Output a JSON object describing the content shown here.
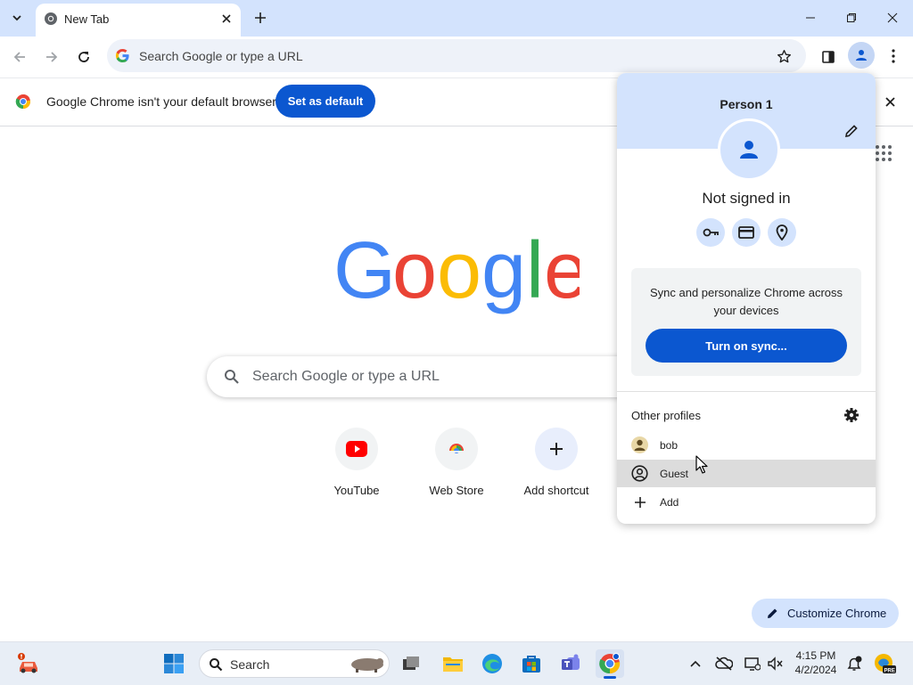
{
  "tab": {
    "title": "New Tab"
  },
  "omnibox": {
    "placeholder": "Search Google or type a URL"
  },
  "infobar": {
    "message": "Google Chrome isn't your default browser",
    "set_default_label": "Set as default"
  },
  "ntp": {
    "search_placeholder": "Search Google or type a URL",
    "shortcuts": [
      {
        "label": "YouTube",
        "icon": "youtube-icon"
      },
      {
        "label": "Web Store",
        "icon": "web-store-icon"
      },
      {
        "label": "Add shortcut",
        "icon": "plus-icon"
      }
    ],
    "customize_label": "Customize Chrome"
  },
  "profile_popup": {
    "name": "Person 1",
    "status": "Not signed in",
    "sync_text": "Sync and personalize Chrome across your devices",
    "sync_button": "Turn on sync...",
    "other_profiles_label": "Other profiles",
    "profiles": [
      {
        "label": "bob",
        "icon": "person-avatar-icon"
      },
      {
        "label": "Guest",
        "icon": "guest-icon"
      },
      {
        "label": "Add",
        "icon": "plus-icon"
      }
    ]
  },
  "taskbar": {
    "search_label": "Search",
    "time": "4:15 PM",
    "date": "4/2/2024"
  },
  "colors": {
    "accent": "#0b57d0",
    "tabstrip": "#d3e3fd",
    "hover_row": "#dcdcdc"
  }
}
